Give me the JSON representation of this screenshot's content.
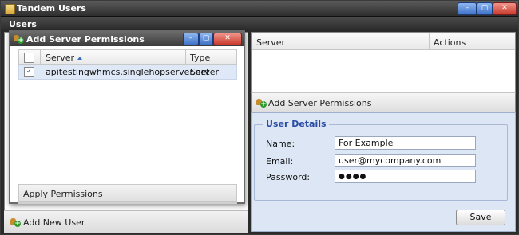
{
  "window": {
    "title": "Tandem Users",
    "controls": [
      "minimize",
      "maximize",
      "close"
    ]
  },
  "users_header": "Users",
  "left_panel": {
    "add_new_user_label": "Add New User"
  },
  "server_panel": {
    "columns": [
      "Server",
      "Actions"
    ],
    "add_server_permissions_label": "Add Server Permissions"
  },
  "user_details": {
    "legend": "User Details",
    "name_label": "Name:",
    "name_value": "For Example",
    "email_label": "Email:",
    "email_value": "user@mycompany.com",
    "password_label": "Password:",
    "password_value": "●●●●",
    "save_label": "Save"
  },
  "modal": {
    "title": "Add Server Permissions",
    "columns": [
      "Server",
      "Type"
    ],
    "rows": [
      {
        "checked": true,
        "server": "apitestingwhmcs.singlehopserver.net",
        "type": "Server"
      }
    ],
    "apply_label": "Apply Permissions"
  },
  "colors": {
    "accent_blue": "#2a4ea6",
    "details_bg": "#dde6f4",
    "selected_row": "#dfe8f6"
  }
}
